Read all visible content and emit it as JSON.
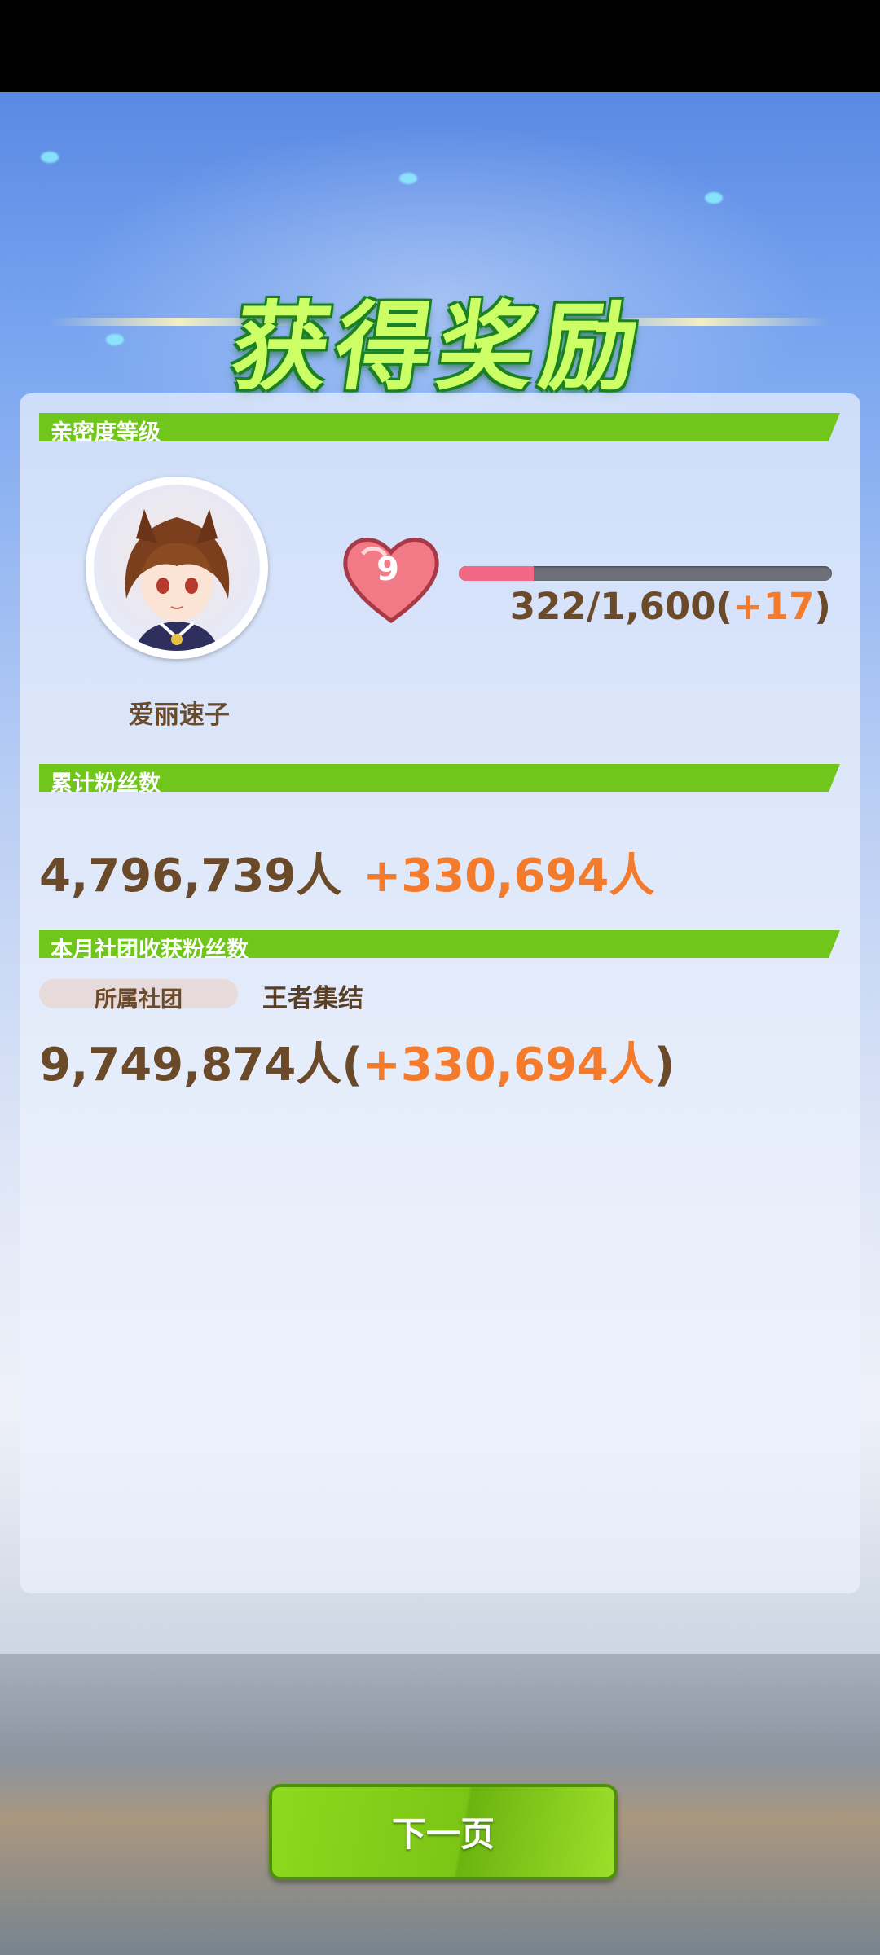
{
  "title": "获得奖励",
  "affection": {
    "section_label": "亲密度等级",
    "character_name": "爱丽速子",
    "level": "9",
    "progress_current": "322",
    "progress_separator": "/",
    "progress_max": "1,600",
    "progress_gain": "+17",
    "progress_fraction": 0.2
  },
  "fans": {
    "section_label": "累计粉丝数",
    "total": "4,796,739人",
    "delta": "+330,694人"
  },
  "club": {
    "section_label": "本月社团收获粉丝数",
    "chip_label": "所属社团",
    "club_name": "王者集结",
    "total": "9,749,874人",
    "delta": "+330,694人"
  },
  "buttons": {
    "next_label": "下一页"
  },
  "colors": {
    "section_green": "#70c61a",
    "text_brown": "#6b4a2a",
    "accent_orange": "#f47a2c",
    "heart_pink": "#f06883"
  },
  "icons": {
    "heart": "heart-icon"
  }
}
